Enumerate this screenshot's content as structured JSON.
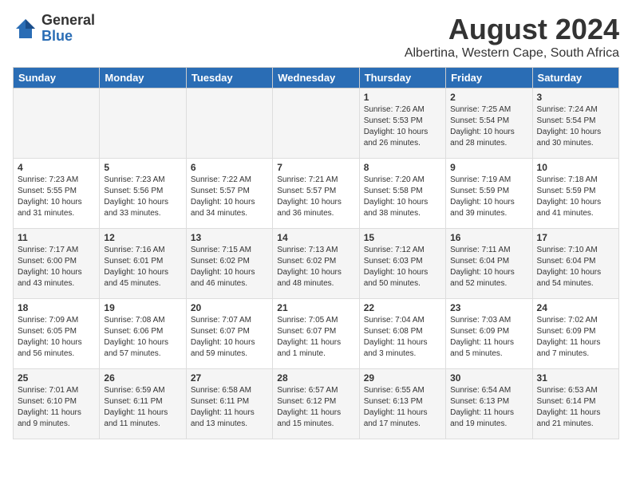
{
  "logo": {
    "general": "General",
    "blue": "Blue"
  },
  "title": "August 2024",
  "location": "Albertina, Western Cape, South Africa",
  "days_of_week": [
    "Sunday",
    "Monday",
    "Tuesday",
    "Wednesday",
    "Thursday",
    "Friday",
    "Saturday"
  ],
  "weeks": [
    [
      {
        "day": "",
        "info": ""
      },
      {
        "day": "",
        "info": ""
      },
      {
        "day": "",
        "info": ""
      },
      {
        "day": "",
        "info": ""
      },
      {
        "day": "1",
        "info": "Sunrise: 7:26 AM\nSunset: 5:53 PM\nDaylight: 10 hours\nand 26 minutes."
      },
      {
        "day": "2",
        "info": "Sunrise: 7:25 AM\nSunset: 5:54 PM\nDaylight: 10 hours\nand 28 minutes."
      },
      {
        "day": "3",
        "info": "Sunrise: 7:24 AM\nSunset: 5:54 PM\nDaylight: 10 hours\nand 30 minutes."
      }
    ],
    [
      {
        "day": "4",
        "info": "Sunrise: 7:23 AM\nSunset: 5:55 PM\nDaylight: 10 hours\nand 31 minutes."
      },
      {
        "day": "5",
        "info": "Sunrise: 7:23 AM\nSunset: 5:56 PM\nDaylight: 10 hours\nand 33 minutes."
      },
      {
        "day": "6",
        "info": "Sunrise: 7:22 AM\nSunset: 5:57 PM\nDaylight: 10 hours\nand 34 minutes."
      },
      {
        "day": "7",
        "info": "Sunrise: 7:21 AM\nSunset: 5:57 PM\nDaylight: 10 hours\nand 36 minutes."
      },
      {
        "day": "8",
        "info": "Sunrise: 7:20 AM\nSunset: 5:58 PM\nDaylight: 10 hours\nand 38 minutes."
      },
      {
        "day": "9",
        "info": "Sunrise: 7:19 AM\nSunset: 5:59 PM\nDaylight: 10 hours\nand 39 minutes."
      },
      {
        "day": "10",
        "info": "Sunrise: 7:18 AM\nSunset: 5:59 PM\nDaylight: 10 hours\nand 41 minutes."
      }
    ],
    [
      {
        "day": "11",
        "info": "Sunrise: 7:17 AM\nSunset: 6:00 PM\nDaylight: 10 hours\nand 43 minutes."
      },
      {
        "day": "12",
        "info": "Sunrise: 7:16 AM\nSunset: 6:01 PM\nDaylight: 10 hours\nand 45 minutes."
      },
      {
        "day": "13",
        "info": "Sunrise: 7:15 AM\nSunset: 6:02 PM\nDaylight: 10 hours\nand 46 minutes."
      },
      {
        "day": "14",
        "info": "Sunrise: 7:13 AM\nSunset: 6:02 PM\nDaylight: 10 hours\nand 48 minutes."
      },
      {
        "day": "15",
        "info": "Sunrise: 7:12 AM\nSunset: 6:03 PM\nDaylight: 10 hours\nand 50 minutes."
      },
      {
        "day": "16",
        "info": "Sunrise: 7:11 AM\nSunset: 6:04 PM\nDaylight: 10 hours\nand 52 minutes."
      },
      {
        "day": "17",
        "info": "Sunrise: 7:10 AM\nSunset: 6:04 PM\nDaylight: 10 hours\nand 54 minutes."
      }
    ],
    [
      {
        "day": "18",
        "info": "Sunrise: 7:09 AM\nSunset: 6:05 PM\nDaylight: 10 hours\nand 56 minutes."
      },
      {
        "day": "19",
        "info": "Sunrise: 7:08 AM\nSunset: 6:06 PM\nDaylight: 10 hours\nand 57 minutes."
      },
      {
        "day": "20",
        "info": "Sunrise: 7:07 AM\nSunset: 6:07 PM\nDaylight: 10 hours\nand 59 minutes."
      },
      {
        "day": "21",
        "info": "Sunrise: 7:05 AM\nSunset: 6:07 PM\nDaylight: 11 hours\nand 1 minute."
      },
      {
        "day": "22",
        "info": "Sunrise: 7:04 AM\nSunset: 6:08 PM\nDaylight: 11 hours\nand 3 minutes."
      },
      {
        "day": "23",
        "info": "Sunrise: 7:03 AM\nSunset: 6:09 PM\nDaylight: 11 hours\nand 5 minutes."
      },
      {
        "day": "24",
        "info": "Sunrise: 7:02 AM\nSunset: 6:09 PM\nDaylight: 11 hours\nand 7 minutes."
      }
    ],
    [
      {
        "day": "25",
        "info": "Sunrise: 7:01 AM\nSunset: 6:10 PM\nDaylight: 11 hours\nand 9 minutes."
      },
      {
        "day": "26",
        "info": "Sunrise: 6:59 AM\nSunset: 6:11 PM\nDaylight: 11 hours\nand 11 minutes."
      },
      {
        "day": "27",
        "info": "Sunrise: 6:58 AM\nSunset: 6:11 PM\nDaylight: 11 hours\nand 13 minutes."
      },
      {
        "day": "28",
        "info": "Sunrise: 6:57 AM\nSunset: 6:12 PM\nDaylight: 11 hours\nand 15 minutes."
      },
      {
        "day": "29",
        "info": "Sunrise: 6:55 AM\nSunset: 6:13 PM\nDaylight: 11 hours\nand 17 minutes."
      },
      {
        "day": "30",
        "info": "Sunrise: 6:54 AM\nSunset: 6:13 PM\nDaylight: 11 hours\nand 19 minutes."
      },
      {
        "day": "31",
        "info": "Sunrise: 6:53 AM\nSunset: 6:14 PM\nDaylight: 11 hours\nand 21 minutes."
      }
    ]
  ]
}
